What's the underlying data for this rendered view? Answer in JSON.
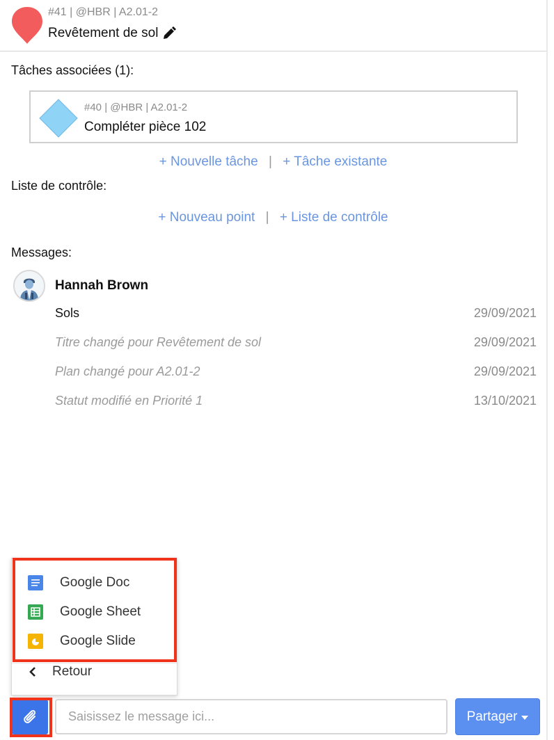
{
  "task": {
    "ref": "#41 | @HBR | A2.01-2",
    "title": "Revêtement de sol",
    "pin_color": "#f25c5c",
    "pin_icon": "map-pin-icon",
    "edit_icon": "pencil-icon"
  },
  "associated": {
    "label": "Tâches associées (1):",
    "cards": [
      {
        "ref": "#40 | @HBR | A2.01-2",
        "title": "Compléter pièce 102",
        "icon": "diamond-icon",
        "color": "#8fd3f7"
      }
    ],
    "new_task": "+ Nouvelle tâche",
    "existing_task": "+ Tâche existante",
    "separator": "|"
  },
  "checklist": {
    "label": "Liste de contrôle:",
    "new_point": "+ Nouveau point",
    "checklist_link": "+ Liste de contrôle",
    "separator": "|"
  },
  "messages": {
    "label": "Messages:",
    "author": "Hannah Brown",
    "items": [
      {
        "text": "Sols",
        "date": "29/09/2021"
      },
      {
        "text": "Titre changé pour Revêtement de sol",
        "date": "29/09/2021"
      },
      {
        "text": "Plan changé pour A2.01-2",
        "date": "29/09/2021"
      },
      {
        "text": "Statut modifié en Priorité 1",
        "date": "13/10/2021"
      }
    ]
  },
  "menu": {
    "items": [
      {
        "label": "Google Doc",
        "icon": "google-doc-icon",
        "color": "#4a86e8"
      },
      {
        "label": "Google Sheet",
        "icon": "google-sheet-icon",
        "color": "#34a853"
      },
      {
        "label": "Google Slide",
        "icon": "google-slide-icon",
        "color": "#f4b400"
      }
    ],
    "back": "Retour",
    "highlight_color": "#f0341c"
  },
  "composer": {
    "attach_icon": "paperclip-icon",
    "placeholder": "Saisissez le message ici...",
    "value": "",
    "share_label": "Partager",
    "accent": "#5b8ff0"
  }
}
